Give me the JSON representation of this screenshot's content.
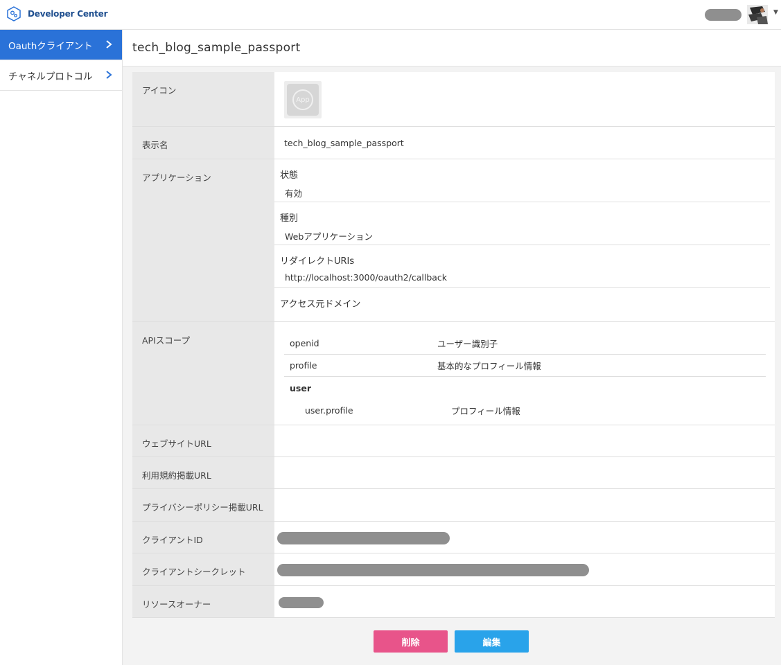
{
  "header": {
    "brand": "Developer Center"
  },
  "sidebar": {
    "items": [
      {
        "label": "Oauthクライアント",
        "active": true
      },
      {
        "label": "チャネルプロトコル",
        "active": false
      }
    ]
  },
  "page": {
    "title": "tech_blog_sample_passport"
  },
  "details": {
    "icon_label": "アイコン",
    "icon_text": "App",
    "display_name_label": "表示名",
    "display_name": "tech_blog_sample_passport",
    "application_label": "アプリケーション",
    "application": {
      "status_label": "状態",
      "status": "有効",
      "type_label": "種別",
      "type": "Webアプリケーション",
      "redirect_label": "リダイレクトURIs",
      "redirect": "http://localhost:3000/oauth2/callback",
      "access_domain_label": "アクセス元ドメイン"
    },
    "api_scope_label": "APIスコープ",
    "scopes": [
      {
        "key": "openid",
        "desc": "ユーザー識別子"
      },
      {
        "key": "profile",
        "desc": "基本的なプロフィール情報"
      }
    ],
    "scope_group": "user",
    "scope_children": [
      {
        "key": "user.profile",
        "desc": "プロフィール情報"
      }
    ],
    "website_label": "ウェブサイトURL",
    "terms_label": "利用規約掲載URL",
    "privacy_label": "プライバシーポリシー掲載URL",
    "client_id_label": "クライアントID",
    "client_secret_label": "クライアントシークレット",
    "resource_owner_label": "リソースオーナー"
  },
  "actions": {
    "delete_label": "削除",
    "edit_label": "編集"
  },
  "colors": {
    "primary": "#2a72d8",
    "delete": "#e8548a",
    "edit": "#29a3ea"
  }
}
